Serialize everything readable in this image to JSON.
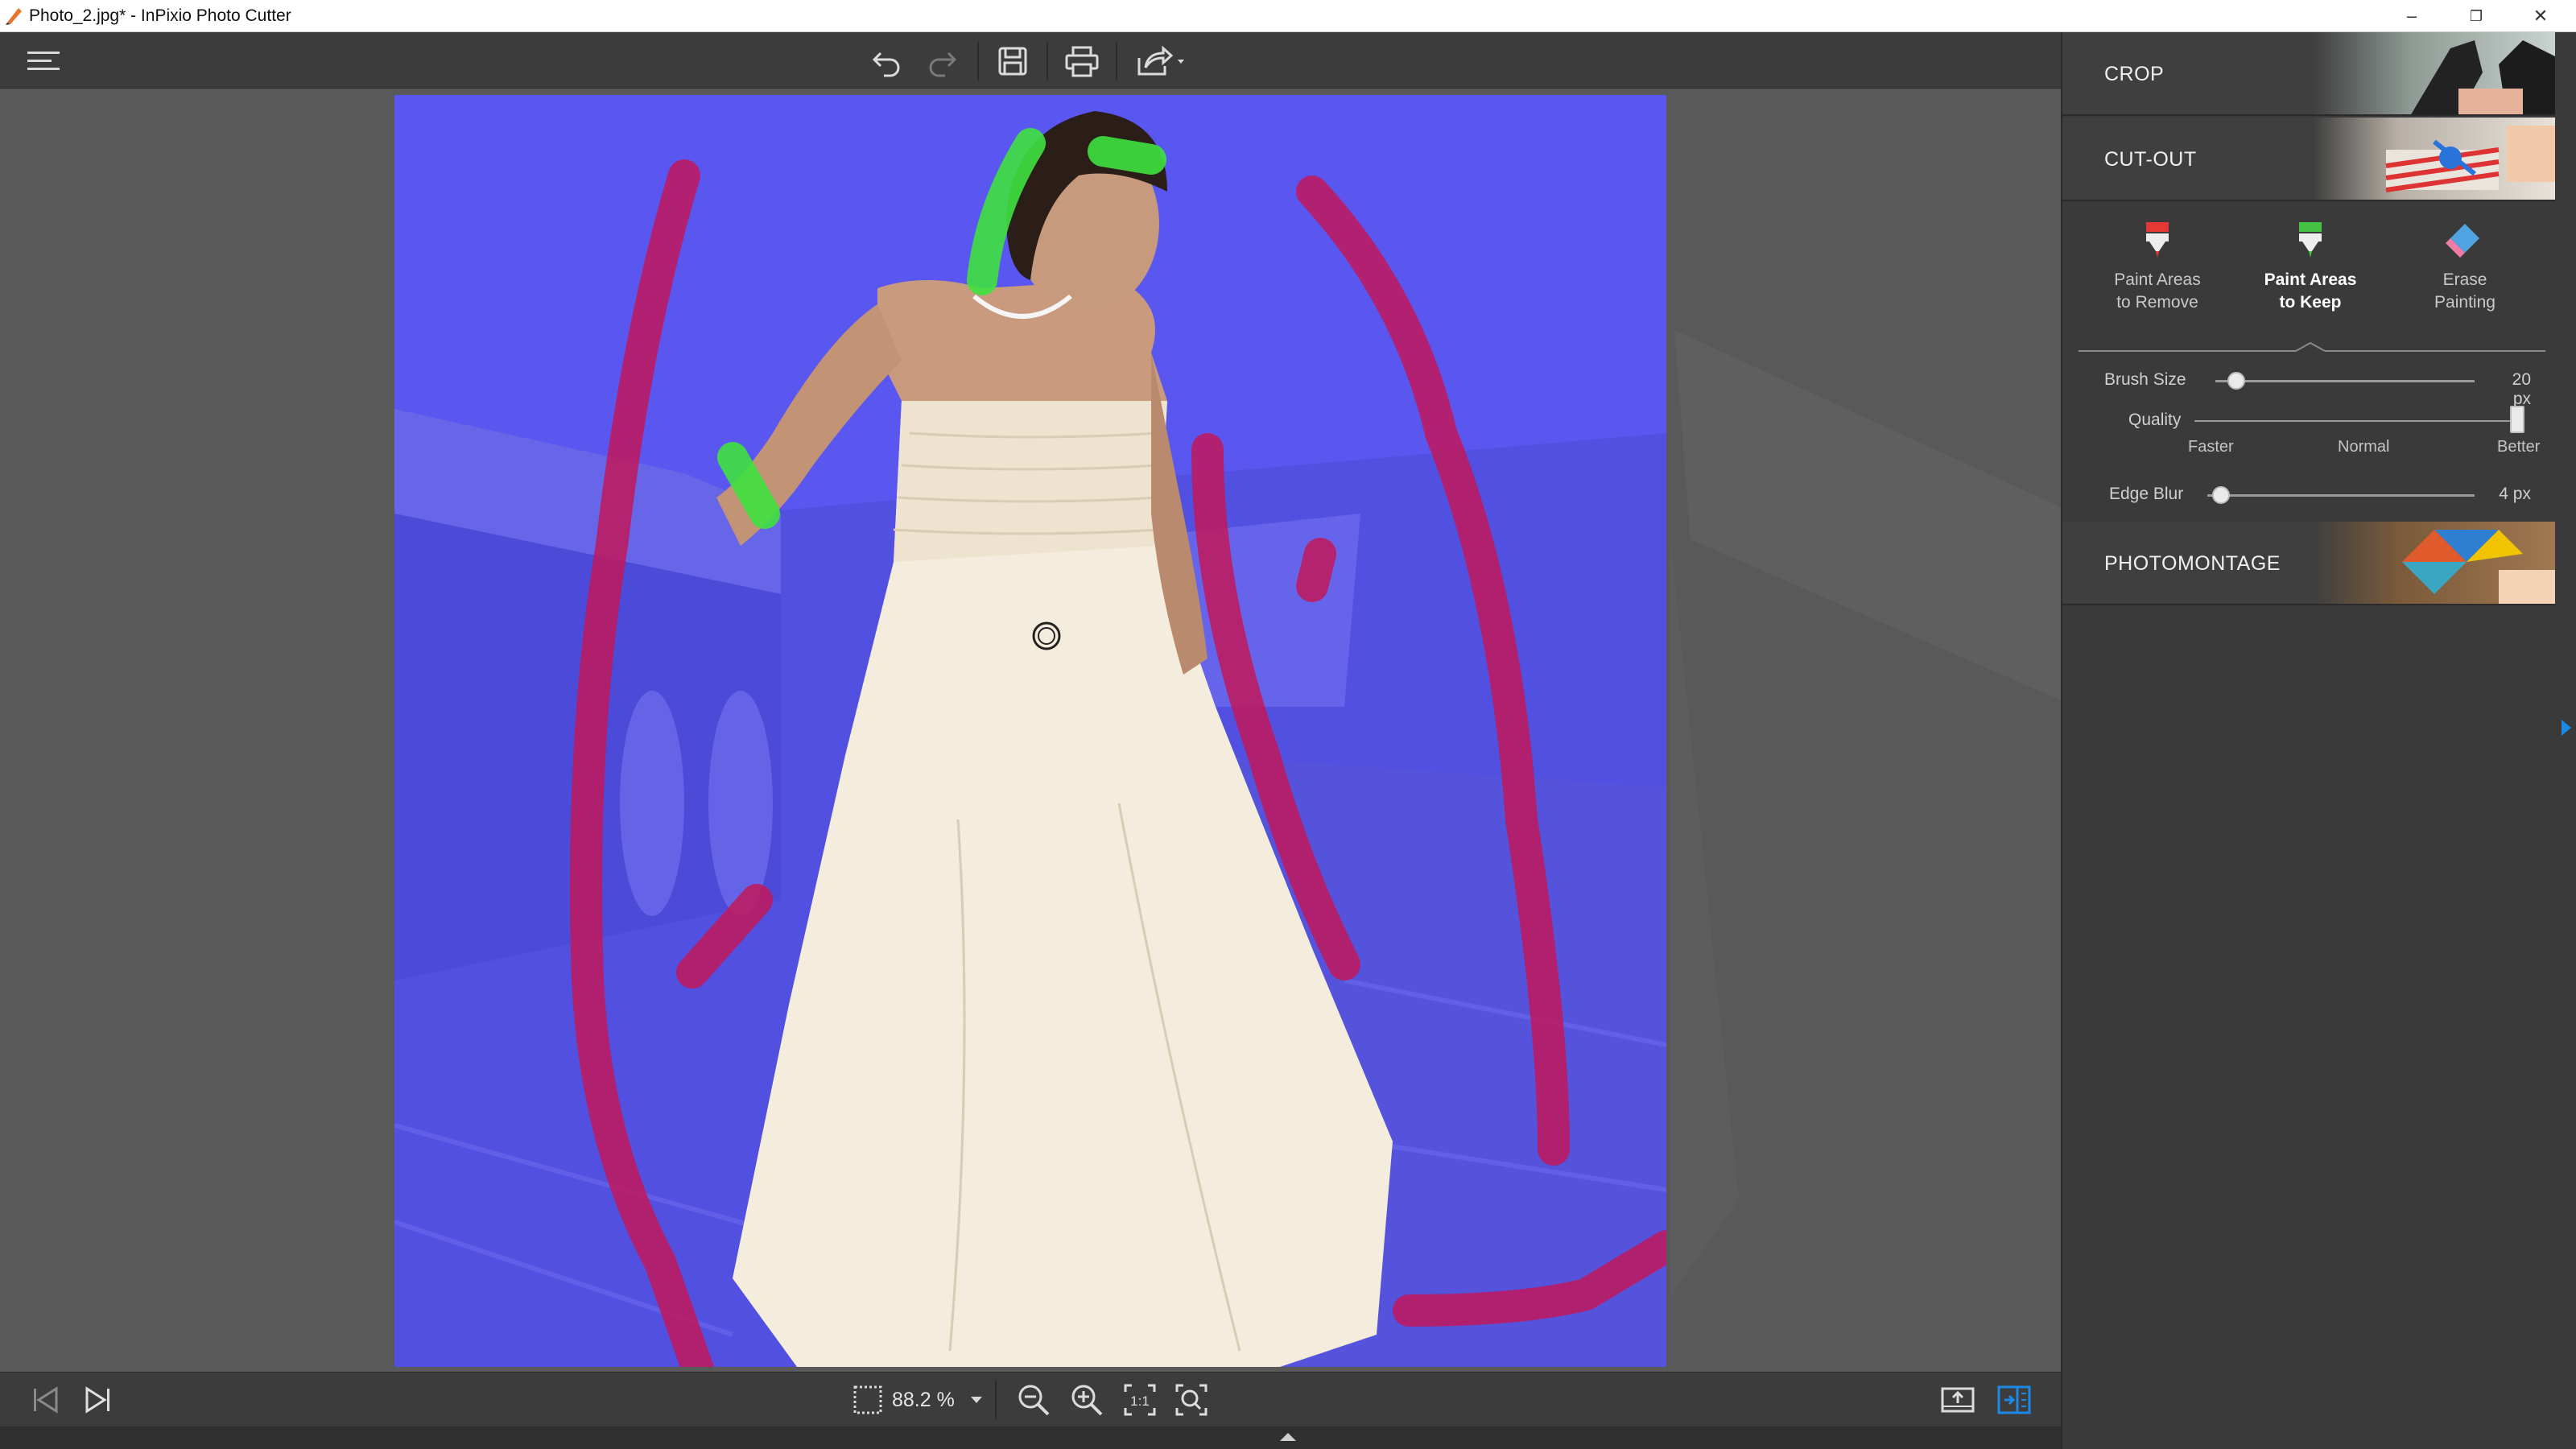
{
  "window": {
    "title": "Photo_2.jpg* - InPixio Photo Cutter",
    "minimize_glyph": "–",
    "restore_glyph": "❐",
    "close_glyph": "✕"
  },
  "toolbar": {
    "icons": [
      "menu-icon",
      "undo-icon",
      "redo-icon",
      "save-icon",
      "print-icon",
      "share-icon"
    ]
  },
  "canvas": {
    "image": "wedding-dress-photo",
    "overlay_color": "#5a5aff",
    "remove_stroke_color": "#c2185b",
    "keep_stroke_color": "#33dd33"
  },
  "bottombar": {
    "zoom": "88.2 %",
    "icons": [
      "first-image-icon",
      "last-image-icon",
      "zoom-fit-icon",
      "zoom-dropdown-icon",
      "zoom-out-icon",
      "zoom-in-icon",
      "zoom-actual-icon",
      "zoom-fit-screen-icon",
      "export-icon",
      "side-by-side-icon"
    ]
  },
  "panel": {
    "crop": {
      "label": "CROP",
      "expanded": false
    },
    "cutout": {
      "label": "CUT-OUT",
      "expanded": true,
      "tools": [
        {
          "line1": "Paint Areas",
          "line2": "to Remove",
          "active": false,
          "color": "#e53935"
        },
        {
          "line1": "Paint Areas",
          "line2": "to Keep",
          "active": true,
          "color": "#43c243"
        },
        {
          "line1": "Erase",
          "line2": "Painting",
          "active": false,
          "color": "#4fa3e0"
        }
      ],
      "brush_size": {
        "label": "Brush Size",
        "value": "20 px",
        "level": 0.08
      },
      "quality": {
        "label": "Quality",
        "ticks": [
          "Faster",
          "Normal",
          "Better"
        ],
        "level": 1.0
      },
      "edge_blur": {
        "label": "Edge Blur",
        "value": "4 px",
        "level": 0.05
      }
    },
    "photomontage": {
      "label": "PHOTOMONTAGE",
      "expanded": false
    }
  },
  "colors": {
    "accent": "#1e88e5",
    "panel_bg": "#3a3a3a",
    "toolbar_bg": "#3c3c3c"
  }
}
